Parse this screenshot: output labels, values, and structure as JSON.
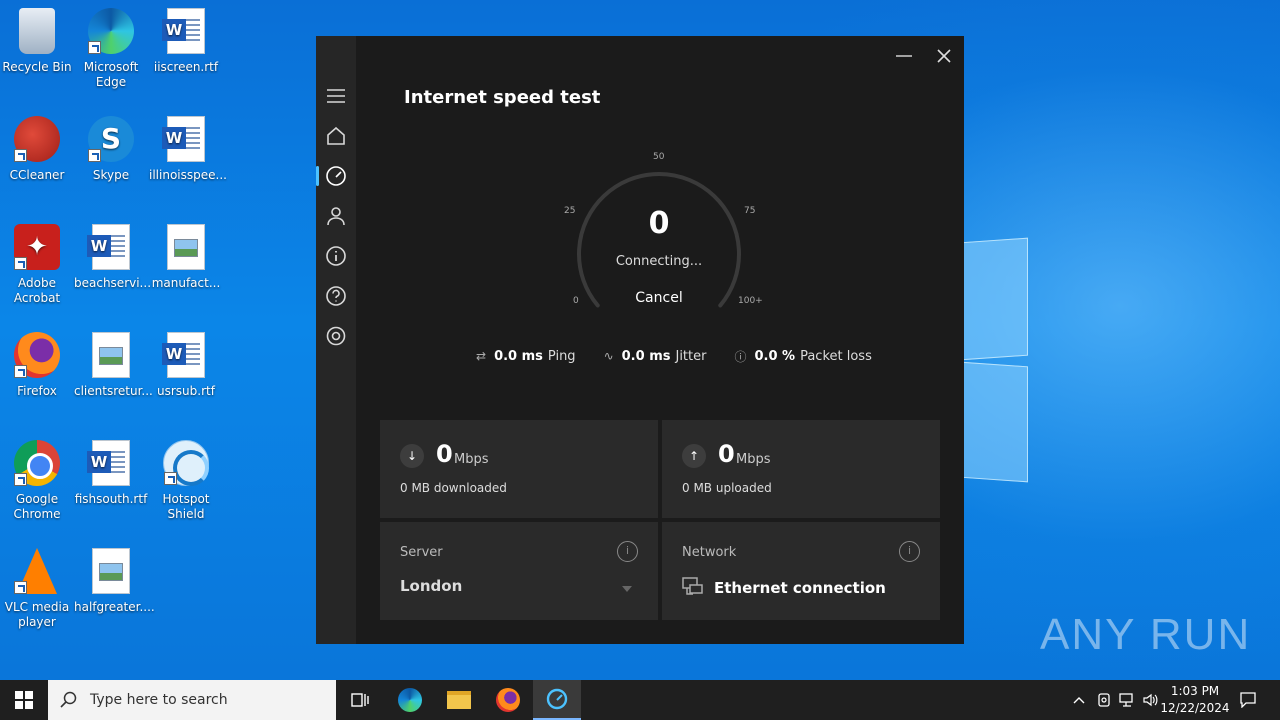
{
  "desktop": {
    "icons": [
      {
        "label": "Recycle Bin"
      },
      {
        "label": "Microsoft Edge"
      },
      {
        "label": "iiscreen.rtf"
      },
      {
        "label": "CCleaner"
      },
      {
        "label": "Skype"
      },
      {
        "label": "illinoisspee..."
      },
      {
        "label": "Adobe Acrobat"
      },
      {
        "label": "beachservi..."
      },
      {
        "label": "manufact..."
      },
      {
        "label": "Firefox"
      },
      {
        "label": "clientsretur..."
      },
      {
        "label": "usrsub.rtf"
      },
      {
        "label": "Google Chrome"
      },
      {
        "label": "fishsouth.rtf"
      },
      {
        "label": "Hotspot Shield"
      },
      {
        "label": "VLC media player"
      },
      {
        "label": "halfgreater...."
      }
    ],
    "watermark": "ANY RUN"
  },
  "app": {
    "title": "Internet speed test",
    "gauge": {
      "value": "0",
      "status": "Connecting...",
      "cancel_label": "Cancel",
      "ticks": [
        "0",
        "25",
        "50",
        "75",
        "100+"
      ],
      "level_fraction": 0
    },
    "stats": [
      {
        "value": "0.0 ms",
        "label": "Ping"
      },
      {
        "value": "0.0 ms",
        "label": "Jitter"
      },
      {
        "value": "0.0 %",
        "label": "Packet loss"
      }
    ],
    "download": {
      "value": "0",
      "unit": "Mbps",
      "sub": "0 MB downloaded"
    },
    "upload": {
      "value": "0",
      "unit": "Mbps",
      "sub": "0 MB uploaded"
    },
    "server": {
      "label": "Server",
      "value": "London"
    },
    "network": {
      "label": "Network",
      "value": "Ethernet connection"
    },
    "accent": "#4cc2ff"
  },
  "taskbar": {
    "search_placeholder": "Type here to search",
    "time": "1:03 PM",
    "date": "12/22/2024"
  }
}
